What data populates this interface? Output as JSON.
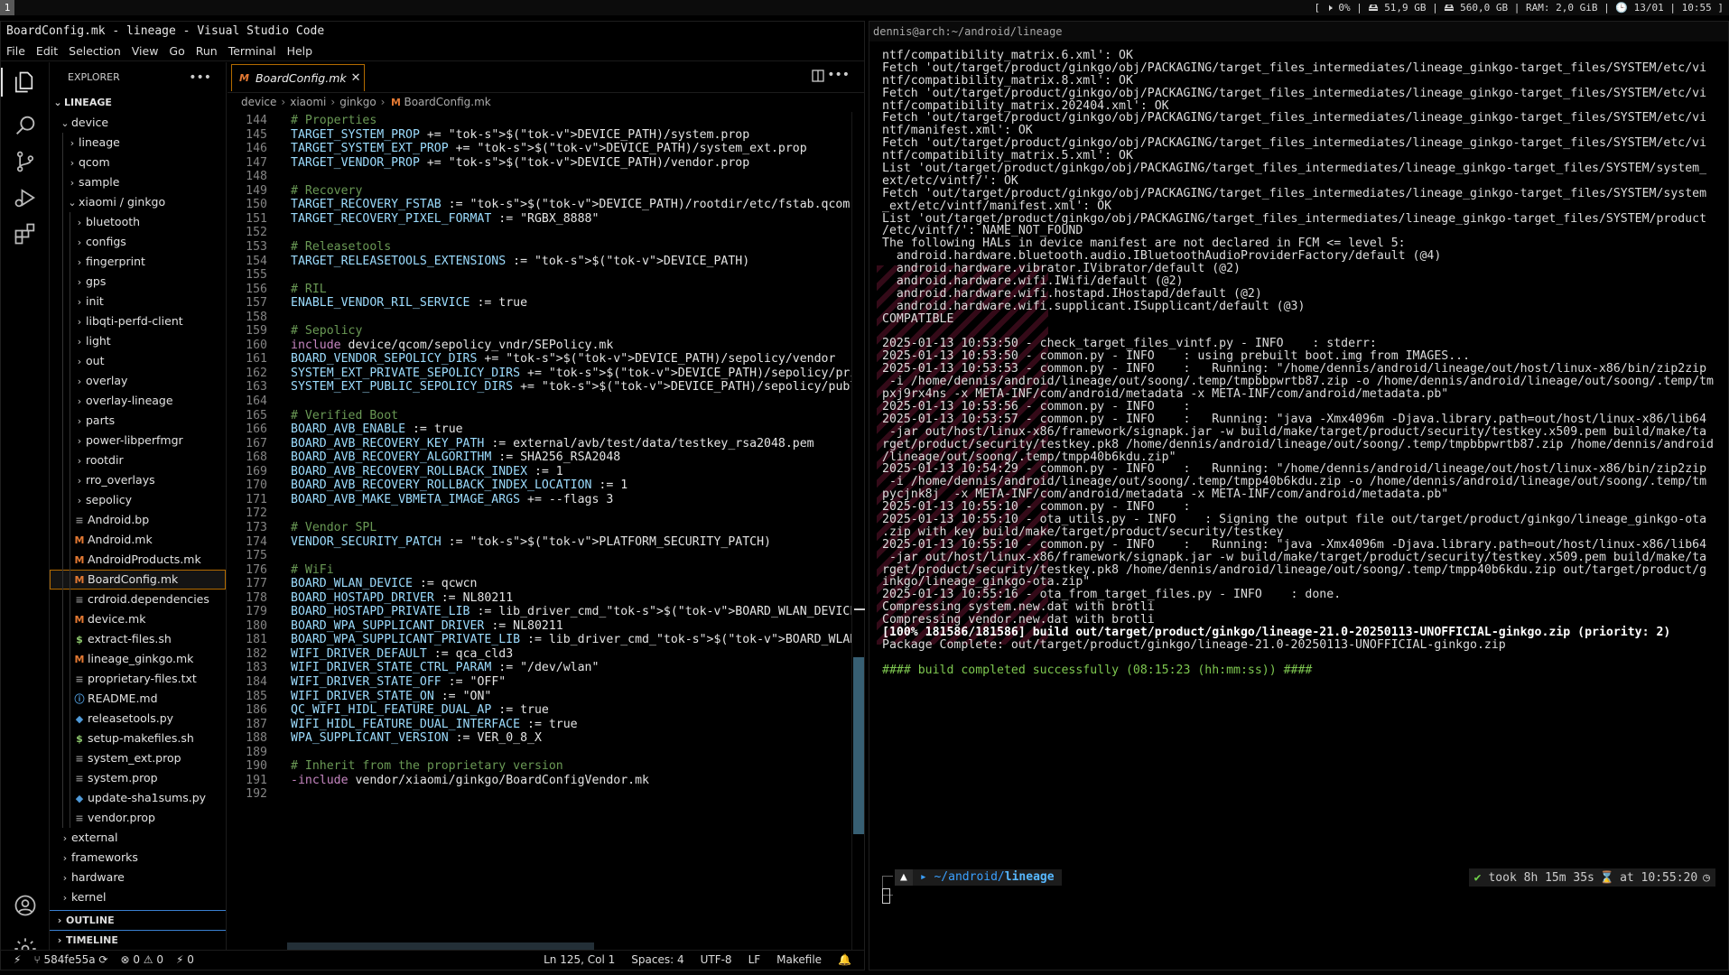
{
  "topbar": {
    "workspace": "1",
    "status": "[ 🕨 0% | 🖴 51,9 GB | 🖴 560,0 GB | RAM: 2,0 GiB | 🕒 13/01 | 10:55 ]"
  },
  "vscode": {
    "title": "BoardConfig.mk - lineage - Visual Studio Code",
    "menu": [
      "File",
      "Edit",
      "Selection",
      "View",
      "Go",
      "Run",
      "Terminal",
      "Help"
    ],
    "explorer_label": "EXPLORER",
    "tree": [
      {
        "label": "LINEAGE",
        "depth": 0,
        "kind": "root"
      },
      {
        "label": "device",
        "depth": 1,
        "kind": "open"
      },
      {
        "label": "lineage",
        "depth": 2,
        "kind": "closed"
      },
      {
        "label": "qcom",
        "depth": 2,
        "kind": "closed"
      },
      {
        "label": "sample",
        "depth": 2,
        "kind": "closed"
      },
      {
        "label": "xiaomi / ginkgo",
        "depth": 2,
        "kind": "open"
      },
      {
        "label": "bluetooth",
        "depth": 3,
        "kind": "closed"
      },
      {
        "label": "configs",
        "depth": 3,
        "kind": "closed"
      },
      {
        "label": "fingerprint",
        "depth": 3,
        "kind": "closed"
      },
      {
        "label": "gps",
        "depth": 3,
        "kind": "closed"
      },
      {
        "label": "init",
        "depth": 3,
        "kind": "closed"
      },
      {
        "label": "libqti-perfd-client",
        "depth": 3,
        "kind": "closed"
      },
      {
        "label": "light",
        "depth": 3,
        "kind": "closed"
      },
      {
        "label": "out",
        "depth": 3,
        "kind": "closed"
      },
      {
        "label": "overlay",
        "depth": 3,
        "kind": "closed"
      },
      {
        "label": "overlay-lineage",
        "depth": 3,
        "kind": "closed"
      },
      {
        "label": "parts",
        "depth": 3,
        "kind": "closed"
      },
      {
        "label": "power-libperfmgr",
        "depth": 3,
        "kind": "closed"
      },
      {
        "label": "rootdir",
        "depth": 3,
        "kind": "closed"
      },
      {
        "label": "rro_overlays",
        "depth": 3,
        "kind": "closed"
      },
      {
        "label": "sepolicy",
        "depth": 3,
        "kind": "closed"
      },
      {
        "label": "Android.bp",
        "depth": 3,
        "kind": "file",
        "icon": "lines"
      },
      {
        "label": "Android.mk",
        "depth": 3,
        "kind": "file",
        "icon": "M"
      },
      {
        "label": "AndroidProducts.mk",
        "depth": 3,
        "kind": "file",
        "icon": "M"
      },
      {
        "label": "BoardConfig.mk",
        "depth": 3,
        "kind": "file",
        "icon": "M",
        "selected": true
      },
      {
        "label": "crdroid.dependencies",
        "depth": 3,
        "kind": "file",
        "icon": "lines"
      },
      {
        "label": "device.mk",
        "depth": 3,
        "kind": "file",
        "icon": "M"
      },
      {
        "label": "extract-files.sh",
        "depth": 3,
        "kind": "file",
        "icon": "$"
      },
      {
        "label": "lineage_ginkgo.mk",
        "depth": 3,
        "kind": "file",
        "icon": "M"
      },
      {
        "label": "proprietary-files.txt",
        "depth": 3,
        "kind": "file",
        "icon": "lines"
      },
      {
        "label": "README.md",
        "depth": 3,
        "kind": "file",
        "icon": "i"
      },
      {
        "label": "releasetools.py",
        "depth": 3,
        "kind": "file",
        "icon": "py"
      },
      {
        "label": "setup-makefiles.sh",
        "depth": 3,
        "kind": "file",
        "icon": "$"
      },
      {
        "label": "system_ext.prop",
        "depth": 3,
        "kind": "file",
        "icon": "lines"
      },
      {
        "label": "system.prop",
        "depth": 3,
        "kind": "file",
        "icon": "lines"
      },
      {
        "label": "update-sha1sums.py",
        "depth": 3,
        "kind": "file",
        "icon": "py"
      },
      {
        "label": "vendor.prop",
        "depth": 3,
        "kind": "file",
        "icon": "lines"
      },
      {
        "label": "external",
        "depth": 1,
        "kind": "closed"
      },
      {
        "label": "frameworks",
        "depth": 1,
        "kind": "closed"
      },
      {
        "label": "hardware",
        "depth": 1,
        "kind": "closed"
      },
      {
        "label": "kernel",
        "depth": 1,
        "kind": "closed"
      }
    ],
    "outline_label": "OUTLINE",
    "timeline_label": "TIMELINE",
    "tab_label": "BoardConfig.mk",
    "breadcrumb": [
      "device",
      "xiaomi",
      "ginkgo",
      "BoardConfig.mk"
    ],
    "code": [
      {
        "n": "144",
        "t": "# Properties"
      },
      {
        "n": "145",
        "t": "TARGET_SYSTEM_PROP += $(DEVICE_PATH)/system.prop"
      },
      {
        "n": "146",
        "t": "TARGET_SYSTEM_EXT_PROP += $(DEVICE_PATH)/system_ext.prop"
      },
      {
        "n": "147",
        "t": "TARGET_VENDOR_PROP += $(DEVICE_PATH)/vendor.prop"
      },
      {
        "n": "148",
        "t": ""
      },
      {
        "n": "149",
        "t": "# Recovery"
      },
      {
        "n": "150",
        "t": "TARGET_RECOVERY_FSTAB := $(DEVICE_PATH)/rootdir/etc/fstab.qcom"
      },
      {
        "n": "151",
        "t": "TARGET_RECOVERY_PIXEL_FORMAT := \"RGBX_8888\""
      },
      {
        "n": "152",
        "t": ""
      },
      {
        "n": "153",
        "t": "# Releasetools"
      },
      {
        "n": "154",
        "t": "TARGET_RELEASETOOLS_EXTENSIONS := $(DEVICE_PATH)"
      },
      {
        "n": "155",
        "t": ""
      },
      {
        "n": "156",
        "t": "# RIL"
      },
      {
        "n": "157",
        "t": "ENABLE_VENDOR_RIL_SERVICE := true"
      },
      {
        "n": "158",
        "t": ""
      },
      {
        "n": "159",
        "t": "# Sepolicy"
      },
      {
        "n": "160",
        "t": "include device/qcom/sepolicy_vndr/SEPolicy.mk"
      },
      {
        "n": "161",
        "t": "BOARD_VENDOR_SEPOLICY_DIRS += $(DEVICE_PATH)/sepolicy/vendor"
      },
      {
        "n": "162",
        "t": "SYSTEM_EXT_PRIVATE_SEPOLICY_DIRS += $(DEVICE_PATH)/sepolicy/private"
      },
      {
        "n": "163",
        "t": "SYSTEM_EXT_PUBLIC_SEPOLICY_DIRS += $(DEVICE_PATH)/sepolicy/public"
      },
      {
        "n": "164",
        "t": ""
      },
      {
        "n": "165",
        "t": "# Verified Boot"
      },
      {
        "n": "166",
        "t": "BOARD_AVB_ENABLE := true"
      },
      {
        "n": "167",
        "t": "BOARD_AVB_RECOVERY_KEY_PATH := external/avb/test/data/testkey_rsa2048.pem"
      },
      {
        "n": "168",
        "t": "BOARD_AVB_RECOVERY_ALGORITHM := SHA256_RSA2048"
      },
      {
        "n": "169",
        "t": "BOARD_AVB_RECOVERY_ROLLBACK_INDEX := 1"
      },
      {
        "n": "170",
        "t": "BOARD_AVB_RECOVERY_ROLLBACK_INDEX_LOCATION := 1"
      },
      {
        "n": "171",
        "t": "BOARD_AVB_MAKE_VBMETA_IMAGE_ARGS += --flags 3"
      },
      {
        "n": "172",
        "t": ""
      },
      {
        "n": "173",
        "t": "# Vendor SPL"
      },
      {
        "n": "174",
        "t": "VENDOR_SECURITY_PATCH := $(PLATFORM_SECURITY_PATCH)"
      },
      {
        "n": "175",
        "t": ""
      },
      {
        "n": "176",
        "t": "# WiFi"
      },
      {
        "n": "177",
        "t": "BOARD_WLAN_DEVICE := qcwcn"
      },
      {
        "n": "178",
        "t": "BOARD_HOSTAPD_DRIVER := NL80211"
      },
      {
        "n": "179",
        "t": "BOARD_HOSTAPD_PRIVATE_LIB := lib_driver_cmd_$(BOARD_WLAN_DEVICE)"
      },
      {
        "n": "180",
        "t": "BOARD_WPA_SUPPLICANT_DRIVER := NL80211"
      },
      {
        "n": "181",
        "t": "BOARD_WPA_SUPPLICANT_PRIVATE_LIB := lib_driver_cmd_$(BOARD_WLAN_DEVICE)"
      },
      {
        "n": "182",
        "t": "WIFI_DRIVER_DEFAULT := qca_cld3"
      },
      {
        "n": "183",
        "t": "WIFI_DRIVER_STATE_CTRL_PARAM := \"/dev/wlan\""
      },
      {
        "n": "184",
        "t": "WIFI_DRIVER_STATE_OFF := \"OFF\""
      },
      {
        "n": "185",
        "t": "WIFI_DRIVER_STATE_ON := \"ON\""
      },
      {
        "n": "186",
        "t": "QC_WIFI_HIDL_FEATURE_DUAL_AP := true"
      },
      {
        "n": "187",
        "t": "WIFI_HIDL_FEATURE_DUAL_INTERFACE := true"
      },
      {
        "n": "188",
        "t": "WPA_SUPPLICANT_VERSION := VER_0_8_X"
      },
      {
        "n": "189",
        "t": ""
      },
      {
        "n": "190",
        "t": "# Inherit from the proprietary version"
      },
      {
        "n": "191",
        "t": "-include vendor/xiaomi/ginkgo/BoardConfigVendor.mk"
      },
      {
        "n": "192",
        "t": ""
      }
    ],
    "status": {
      "branch": "584fe55a",
      "problems": "⊗ 0 ⚠ 0",
      "ports": "⚡ 0",
      "position": "Ln 125, Col 1",
      "spaces": "Spaces: 4",
      "encoding": "UTF-8",
      "eol": "LF",
      "language": "Makefile"
    }
  },
  "terminal": {
    "title": "dennis@arch:~/android/lineage",
    "lines": [
      "ntf/compatibility_matrix.6.xml': OK",
      "Fetch 'out/target/product/ginkgo/obj/PACKAGING/target_files_intermediates/lineage_ginkgo-target_files/SYSTEM/etc/vi",
      "ntf/compatibility_matrix.8.xml': OK",
      "Fetch 'out/target/product/ginkgo/obj/PACKAGING/target_files_intermediates/lineage_ginkgo-target_files/SYSTEM/etc/vi",
      "ntf/compatibility_matrix.202404.xml': OK",
      "Fetch 'out/target/product/ginkgo/obj/PACKAGING/target_files_intermediates/lineage_ginkgo-target_files/SYSTEM/etc/vi",
      "ntf/manifest.xml': OK",
      "Fetch 'out/target/product/ginkgo/obj/PACKAGING/target_files_intermediates/lineage_ginkgo-target_files/SYSTEM/etc/vi",
      "ntf/compatibility_matrix.5.xml': OK",
      "List 'out/target/product/ginkgo/obj/PACKAGING/target_files_intermediates/lineage_ginkgo-target_files/SYSTEM/system_",
      "ext/etc/vintf/': OK",
      "Fetch 'out/target/product/ginkgo/obj/PACKAGING/target_files_intermediates/lineage_ginkgo-target_files/SYSTEM/system",
      "_ext/etc/vintf/manifest.xml': OK",
      "List 'out/target/product/ginkgo/obj/PACKAGING/target_files_intermediates/lineage_ginkgo-target_files/SYSTEM/product",
      "/etc/vintf/': NAME_NOT_FOUND",
      "The following HALs in device manifest are not declared in FCM <= level 5:",
      "  android.hardware.bluetooth.audio.IBluetoothAudioProviderFactory/default (@4)",
      "  android.hardware.vibrator.IVibrator/default (@2)",
      "  android.hardware.wifi.IWifi/default (@2)",
      "  android.hardware.wifi.hostapd.IHostapd/default (@2)",
      "  android.hardware.wifi.supplicant.ISupplicant/default (@3)",
      "COMPATIBLE",
      "",
      "2025-01-13 10:53:50 - check_target_files_vintf.py - INFO    : stderr:",
      "2025-01-13 10:53:50 - common.py - INFO    : using prebuilt boot.img from IMAGES...",
      "2025-01-13 10:53:53 - common.py - INFO    :   Running: \"/home/dennis/android/lineage/out/host/linux-x86/bin/zip2zip",
      " -i /home/dennis/android/lineage/out/soong/.temp/tmpbbpwrtb87.zip -o /home/dennis/android/lineage/out/soong/.temp/tm",
      "pxj9rx4ns -x META-INF/com/android/metadata -x META-INF/com/android/metadata.pb\"",
      "2025-01-13 10:53:56 - common.py - INFO    :",
      "2025-01-13 10:53:57 - common.py - INFO    :   Running: \"java -Xmx4096m -Djava.library.path=out/host/linux-x86/lib64",
      " -jar out/host/linux-x86/framework/signapk.jar -w build/make/target/product/security/testkey.x509.pem build/make/ta",
      "rget/product/security/testkey.pk8 /home/dennis/android/lineage/out/soong/.temp/tmpbbpwrtb87.zip /home/dennis/android",
      "/lineage/out/soong/.temp/tmpp40b6kdu.zip\"",
      "2025-01-13 10:54:29 - common.py - INFO    :   Running: \"/home/dennis/android/lineage/out/host/linux-x86/bin/zip2zip",
      " -i /home/dennis/android/lineage/out/soong/.temp/tmpp40b6kdu.zip -o /home/dennis/android/lineage/out/soong/.temp/tm",
      "pycjnk8j  -x META-INF/com/android/metadata -x META-INF/com/android/metadata.pb\"",
      "2025-01-13 10:55:10 - common.py - INFO    :",
      "2025-01-13 10:55:10 - ota_utils.py - INFO    : Signing the output file out/target/product/ginkgo/lineage_ginkgo-ota",
      ".zip with key build/make/target/product/security/testkey",
      "2025-01-13 10:55:10 - common.py - INFO    :   Running: \"java -Xmx4096m -Djava.library.path=out/host/linux-x86/lib64",
      " -jar out/host/linux-x86/framework/signapk.jar -w build/make/target/product/security/testkey.x509.pem build/make/ta",
      "rget/product/security/testkey.pk8 /home/dennis/android/lineage/out/soong/.temp/tmpp40b6kdu.zip out/target/product/g",
      "inkgo/lineage_ginkgo-ota.zip\"",
      "2025-01-13 10:55:16 - ota_from_target_files.py - INFO    : done.",
      "Compressing system.new.dat with brotli",
      "Compressing vendor.new.dat with brotli"
    ],
    "build_line": "[100% 181586/181586] build out/target/product/ginkgo/lineage-21.0-20250113-UNOFFICIAL-ginkgo.zip (priority: 2)",
    "package_line": "Package Complete: out/target/product/ginkgo/lineage-21.0-20250113-UNOFFICIAL-ginkgo.zip",
    "success_line": "#### build completed successfully (08:15:23 (hh:mm:ss)) ####",
    "prompt": {
      "path_prefix": "~/android/",
      "path_dir": "lineage",
      "took": "took 8h 15m 35s",
      "at": "at 10:55:20"
    }
  },
  "colors": {
    "accent_orange": "#b36b00",
    "scroll_thumb": "#4a7f9a",
    "success_green": "#7ec850"
  }
}
